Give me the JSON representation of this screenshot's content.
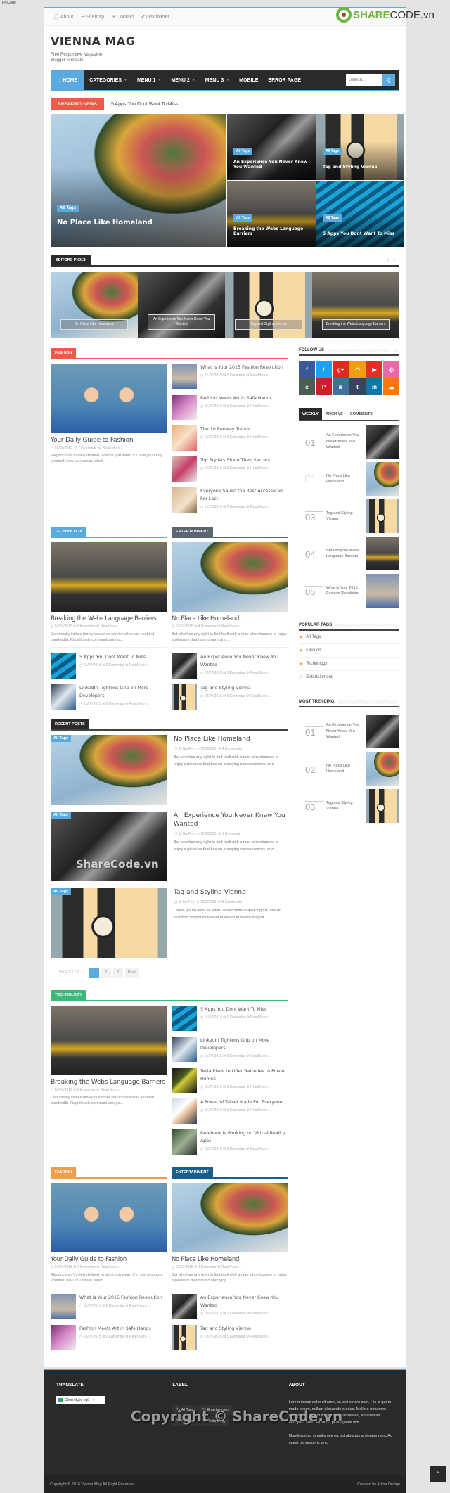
{
  "window_caption": "ProCode",
  "watermark": {
    "brand_a": "SHARE",
    "brand_b": "CODE.vn",
    "overlay_mid": "ShareCode.vn",
    "overlay_footer": "Copyright © ShareCode.vn"
  },
  "topbar": {
    "links": [
      {
        "icon": "user-icon",
        "label": "About"
      },
      {
        "icon": "list-icon",
        "label": "Sitemap"
      },
      {
        "icon": "envelope-icon",
        "label": "Contact"
      },
      {
        "icon": "check-circle-icon",
        "label": "Disclaimer"
      }
    ]
  },
  "brand": {
    "title": "VIENNA MAG",
    "tagline": "Free Responsive Magazine Blogger Template"
  },
  "nav": {
    "items": [
      {
        "label": "HOME",
        "icon": "home-icon",
        "active": true
      },
      {
        "label": "CATEGORIES",
        "dropdown": true
      },
      {
        "label": "MENU 1",
        "dropdown": true
      },
      {
        "label": "MENU 2",
        "dropdown": true
      },
      {
        "label": "MENU 3",
        "dropdown": true
      },
      {
        "label": "MOBILE"
      },
      {
        "label": "ERROR PAGE"
      }
    ],
    "search_placeholder": "Search...",
    "accent": "#5aaadf"
  },
  "breaking": {
    "label": "BREAKING NEWS",
    "text": "5 Apps You Dont Want To Miss"
  },
  "hero": [
    {
      "tag": "All Tags",
      "title": "No Place Like Homeland"
    },
    {
      "tag": "All Tags",
      "title": "An Experience You Never Knew You Wanted"
    },
    {
      "tag": "All Tags",
      "title": "Tag and Styling Vienna"
    },
    {
      "tag": "All Tags",
      "title": "Breaking the Webs Language Barriers"
    },
    {
      "tag": "All Tags",
      "title": "5 Apps You Dont Want To Miss"
    }
  ],
  "editors_picks": {
    "title": "EDITORS PICKS",
    "prev": "‹",
    "next": "›",
    "items": [
      "No Place Like Homeland",
      "An Experience You Never Knew You Wanted",
      "Tag and Styling Vienna",
      "Breaking the Webs Language Barriers"
    ]
  },
  "fashion": {
    "label": "FASHION",
    "color": "#f15a4a",
    "feature": {
      "title": "Your Daily Guide to Fashion",
      "date": "01/07/2015",
      "comments": "7 Komentar",
      "more": "Read More...",
      "excerpt": "Elegance isn't solely defined by what you wear. It's how you carry yourself, how you speak, what..."
    },
    "list": [
      {
        "title": "What is Your 2015 Fashion Resolution",
        "date": "01/07/2015",
        "comments": "0 Komentar",
        "more": "Read More..."
      },
      {
        "title": "Fashion Meets Art in Safe Hands",
        "date": "01/07/2015",
        "comments": "0 Komentar",
        "more": "Read More..."
      },
      {
        "title": "The 10 Runway Trends",
        "date": "01/07/2015",
        "comments": "0 Komentar",
        "more": "Read More..."
      },
      {
        "title": "Top Stylists Share Their Secrets",
        "date": "01/07/2015",
        "comments": "0 Komentar",
        "more": "Read More..."
      },
      {
        "title": "Everyone Saved the Best Accessories For Last",
        "date": "01/07/2015",
        "comments": "0 Komentar",
        "more": "Read More..."
      }
    ]
  },
  "tech": {
    "label": "TECHNOLOGY",
    "color": "#5aaadf",
    "feature": {
      "title": "Breaking the Webs Language Barriers",
      "date": "01/07/2015",
      "comments": "6 Komentar",
      "more": "Read More...",
      "excerpt": "Continually initiate timely customer service whereas enabled bandwidth. Rapidiously communicate go..."
    },
    "list": [
      {
        "title": "5 Apps You Dont Want To Miss",
        "date": "01/07/2015",
        "comments": "0 Komentar",
        "more": "Read More..."
      },
      {
        "title": "LinkedIn Tightens Grip on More Developers",
        "date": "01/07/2015",
        "comments": "0 Komentar",
        "more": "Read More..."
      }
    ]
  },
  "ent": {
    "label": "ENTERTAINMENT",
    "color": "#5b6670",
    "feature": {
      "title": "No Place Like Homeland",
      "date": "02/07/2015",
      "comments": "4 Komentar",
      "more": "Read More...",
      "excerpt": "But who has any right to find fault with a man who chooses to enjoy a pleasure that has no annoying..."
    },
    "list": [
      {
        "title": "An Experience You Never Knew You Wanted",
        "date": "02/07/2015",
        "comments": "1 Komentar",
        "more": "Read More..."
      },
      {
        "title": "Tag and Styling Vienna",
        "date": "02/07/2015",
        "comments": "5 Komentar",
        "more": "Read More..."
      }
    ]
  },
  "recent": {
    "label": "RECENT POSTS",
    "posts": [
      {
        "tag": "All Tags",
        "title": "No Place Like Homeland",
        "author": "Li Na Fen",
        "date": "7/02/2015",
        "comments": "4 Comments",
        "excerpt": "But who has any right to find fault with a man who chooses to enjoy a pleasure that has no annoying consequences, or o"
      },
      {
        "tag": "All Tags",
        "title": "An Experience You Never Knew You Wanted",
        "author": "Li Na Fen",
        "date": "7/02/2015",
        "comments": "1 Comment",
        "excerpt": "But who has any right to find fault with a man who chooses to enjoy a pleasure that has no annoying consequences, or o"
      },
      {
        "tag": "All Tags",
        "title": "Tag and Styling Vienna",
        "author": "Li Na Fen",
        "date": "7/02/2015",
        "comments": "5 Comments",
        "excerpt": "Lorem ipsum dolor sit amet, consectetur adipisicing elit, sed do eiusmod tempor incididunt ut labore et dolore magna"
      }
    ],
    "pager": {
      "text": "PAGES 1 OF 3",
      "pages": [
        "1",
        "2",
        "3"
      ],
      "current": "1",
      "next": "Next"
    }
  },
  "tech2": {
    "label": "TECHNOLOGY",
    "color": "#3cb878",
    "feature": {
      "title": "Breaking the Webs Language Barriers",
      "date": "01/07/2015",
      "comments": "6 Komentar",
      "more": "Read More...",
      "excerpt": "Continually initiate timely customer service whereas enabled bandwidth. Rapidiously communicate go..."
    },
    "list": [
      {
        "title": "5 Apps You Dont Want To Miss",
        "date": "01/07/2015",
        "comments": "0 Komentar",
        "more": "Read More..."
      },
      {
        "title": "LinkedIn Tightens Grip on More Developers",
        "date": "01/07/2015",
        "comments": "0 Komentar",
        "more": "Read More..."
      },
      {
        "title": "Tesla Plans to Offer Batteries to Power Homes",
        "date": "01/07/2015",
        "comments": "0 Komentar",
        "more": "Read More..."
      },
      {
        "title": "A Powerful Tablet Made For Everyone",
        "date": "01/07/2015",
        "comments": "0 Komentar",
        "more": "Read More..."
      },
      {
        "title": "Facebook is Working on Virtual Reality Apps",
        "date": "01/07/2015",
        "comments": "0 Komentar",
        "more": "Read More..."
      }
    ]
  },
  "fashion2": {
    "label": "FASHION",
    "color": "#f39c4a",
    "feature": {
      "title": "Your Daily Guide to Fashion",
      "date": "01/07/2015",
      "comments": "7 Komentar",
      "more": "Read More...",
      "excerpt": "Elegance isn't solely defined by what you wear. It's how you carry yourself, how you speak, what..."
    },
    "list": [
      {
        "title": "What is Your 2015 Fashion Resolution",
        "date": "01/07/2015",
        "comments": "0 Komentar",
        "more": "Read More..."
      },
      {
        "title": "Fashion Meets Art in Safe Hands",
        "date": "01/07/2015",
        "comments": "0 Komentar",
        "more": "Read More..."
      }
    ]
  },
  "ent2": {
    "label": "ENTERTAINMENT",
    "color": "#1a5f8c",
    "feature": {
      "title": "No Place Like Homeland",
      "date": "02/07/2015",
      "comments": "4 Komentar",
      "more": "Read More...",
      "excerpt": "But who has any right to find fault with a man who chooses to enjoy a pleasure that has no annoying..."
    },
    "list": [
      {
        "title": "An Experience You Never Knew You Wanted",
        "date": "02/07/2015",
        "comments": "1 Komentar",
        "more": "Read More..."
      },
      {
        "title": "Tag and Styling Vienna",
        "date": "02/07/2015",
        "comments": "5 Komentar",
        "more": "Read More..."
      }
    ]
  },
  "sidebar": {
    "follow_title": "FOLLOW US",
    "social": [
      {
        "name": "facebook",
        "glyph": "f",
        "color": "#3b5998"
      },
      {
        "name": "twitter",
        "glyph": "t",
        "color": "#1da1f2"
      },
      {
        "name": "google-plus",
        "glyph": "g+",
        "color": "#dd2c1f"
      },
      {
        "name": "rss",
        "glyph": "◠",
        "color": "#f39c12"
      },
      {
        "name": "youtube",
        "glyph": "▶",
        "color": "#e52d27"
      },
      {
        "name": "dribbble",
        "glyph": "◎",
        "color": "#ea6aa8"
      },
      {
        "name": "deviantart",
        "glyph": "ƨ",
        "color": "#4b5e52"
      },
      {
        "name": "pinterest",
        "glyph": "P",
        "color": "#cb2027"
      },
      {
        "name": "instagram",
        "glyph": "◙",
        "color": "#3f729b"
      },
      {
        "name": "tumblr",
        "glyph": "t",
        "color": "#35465c"
      },
      {
        "name": "linkedin",
        "glyph": "in",
        "color": "#0e76a8"
      },
      {
        "name": "soundcloud",
        "glyph": "☁",
        "color": "#ff7700"
      }
    ],
    "tabs": [
      "WEEKLY",
      "ARCHIVE",
      "COMMENTS"
    ],
    "weekly": [
      {
        "num": "01",
        "title": "An Experience You Never Knew You Wanted"
      },
      {
        "num": "",
        "icon": "folder-icon",
        "title": "No Place Like Homeland"
      },
      {
        "num": "03",
        "title": "Tag and Styling Vienna"
      },
      {
        "num": "04",
        "title": "Breaking the Webs Language Barriers"
      },
      {
        "num": "05",
        "title": "What is Your 2015 Fashion Resolution"
      }
    ],
    "tags_title": "POPULAR TAGS",
    "tags": [
      {
        "label": "All Tags",
        "star": "★"
      },
      {
        "label": "Fashion",
        "star": "★"
      },
      {
        "label": "Technology",
        "star": "★"
      },
      {
        "label": "Entertainment",
        "star": "☆"
      }
    ],
    "trend_title": "MOST TRENDING",
    "trending": [
      {
        "num": "01",
        "title": "An Experience You Never Knew You Wanted"
      },
      {
        "num": "02",
        "title": "No Place Like Homeland"
      },
      {
        "num": "03",
        "title": "Tag and Styling Vienna"
      }
    ]
  },
  "footer": {
    "translate_title": "TRANSLATE",
    "translate_select": "Chọn Ngôn ngữ",
    "label_title": "LABEL",
    "labels": [
      "All Tags",
      "Entertainment",
      "Fashion",
      "Technology"
    ],
    "about_title": "ABOUT",
    "about_p1": "Lorem ipsum dolor sit amet, at wisi cetero cum. His id quem modo solum, nullam aliquando eu duo. Meliore nonumes oportere id. Mundi scripta singulis sea eu, ad albucius antiopam mea. Ad mutat persequeris vim.",
    "about_p2": "Mundi scripta singulis sea eu, ad albucius antiopam mea. Ad mutat persequeris vim.",
    "copyright": "Copyright © 2016 Vienna Mag All Right Reserved",
    "credit": "Created by Arlina Design",
    "back_to_top": "⌃"
  }
}
